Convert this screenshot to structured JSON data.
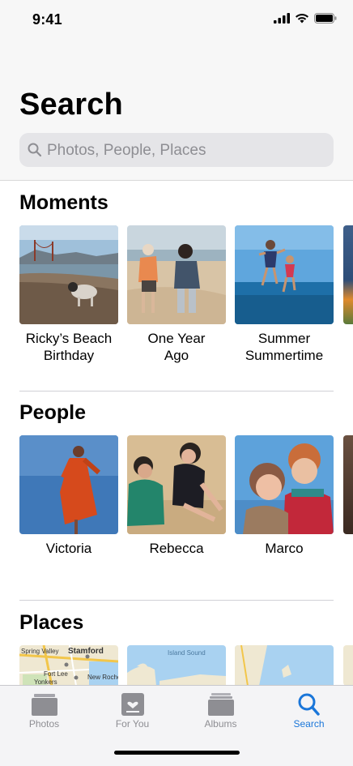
{
  "status_bar": {
    "time": "9:41"
  },
  "header": {
    "title": "Search",
    "search": {
      "placeholder": "Photos, People, Places",
      "value": ""
    }
  },
  "sections": {
    "moments": {
      "title": "Moments",
      "items": [
        {
          "line1": "Ricky’s Beach",
          "line2": "Birthday"
        },
        {
          "line1": "One Year",
          "line2": "Ago"
        },
        {
          "line1": "Summer",
          "line2": "Summertime"
        }
      ]
    },
    "people": {
      "title": "People",
      "items": [
        {
          "name": "Victoria"
        },
        {
          "name": "Rebecca"
        },
        {
          "name": "Marco"
        }
      ]
    },
    "places": {
      "title": "Places",
      "map_labels": [
        "Spring Valley",
        "Stamford",
        "Fort Lee",
        "Yonkers",
        "New Rochelle",
        "Island Sound"
      ]
    }
  },
  "tab_bar": {
    "tabs": [
      {
        "label": "Photos",
        "icon": "photos-icon"
      },
      {
        "label": "For You",
        "icon": "for-you-icon"
      },
      {
        "label": "Albums",
        "icon": "albums-icon"
      },
      {
        "label": "Search",
        "icon": "search-icon"
      }
    ],
    "active": "Search"
  },
  "colors": {
    "accent": "#1a76d9",
    "header_bg": "#f7f7f7",
    "tab_inactive": "#8e8e93"
  }
}
